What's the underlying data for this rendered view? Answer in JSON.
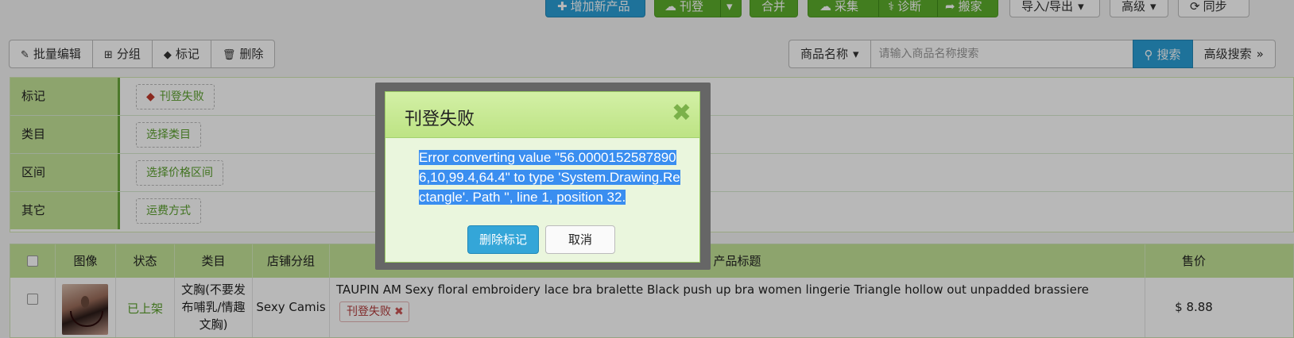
{
  "toolbar": {
    "add_product": "增加新产品",
    "publish": "刊登",
    "merge": "合并",
    "collect": "采集",
    "diagnose": "诊断",
    "move": "搬家",
    "import_export": "导入/导出",
    "advanced": "高级",
    "sync": "同步"
  },
  "actions": {
    "bulk_edit": "批量编辑",
    "group": "分组",
    "mark": "标记",
    "delete": "删除"
  },
  "search": {
    "field": "商品名称",
    "placeholder": "请输入商品名称搜索",
    "button": "搜索",
    "advanced": "高级搜索"
  },
  "filters": [
    {
      "label": "标记",
      "value": "刊登失败"
    },
    {
      "label": "类目",
      "value": "选择类目"
    },
    {
      "label": "区间",
      "value": "选择价格区间"
    },
    {
      "label": "其它",
      "value": "运费方式"
    }
  ],
  "table": {
    "headers": {
      "image": "图像",
      "status": "状态",
      "category": "类目",
      "store_group": "店铺分组",
      "title": "产品标题",
      "price": "售价"
    },
    "row": {
      "status": "已上架",
      "category": "文胸(不要发布哺乳/情趣文胸)",
      "store_group": "Sexy Camis",
      "title": "TAUPIN AM Sexy floral embroidery lace bra bralette Black push up bra women lingerie Triangle hollow out unpadded brassiere",
      "tag": "刊登失败",
      "price": "$ 8.88"
    }
  },
  "modal": {
    "title": "刊登失败",
    "message": "Error converting value \"56.00001525878906,10,99.4,64.4\" to type 'System.Drawing.Rectangle'. Path '', line 1, position 32.",
    "confirm": "删除标记",
    "cancel": "取消"
  },
  "colors": {
    "accent_blue": "#2a9fd6",
    "accent_green": "#5cae2b",
    "panel_green": "#c4e398",
    "selection": "#3a8ef0"
  }
}
